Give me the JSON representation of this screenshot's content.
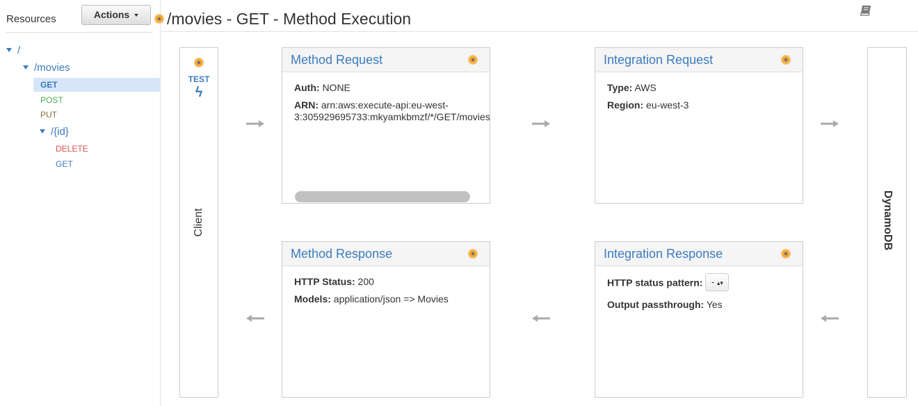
{
  "sidebar": {
    "title": "Resources",
    "actions_label": "Actions",
    "tree": {
      "root": "/",
      "movies": "/movies",
      "movies_methods": {
        "get": "GET",
        "post": "POST",
        "put": "PUT"
      },
      "id": "/{id}",
      "id_methods": {
        "delete": "DELETE",
        "get": "GET"
      }
    }
  },
  "header": {
    "title": "/movies - GET - Method Execution"
  },
  "client": {
    "test_label": "TEST",
    "bolt": "ϟ",
    "label": "Client"
  },
  "backend": {
    "label": "DynamoDB"
  },
  "method_request": {
    "title": "Method Request",
    "auth_label": "Auth:",
    "auth_value": "NONE",
    "arn_label": "ARN:",
    "arn_value": "arn:aws:execute-api:eu-west-3:305929695733:mkyamkbmzf/*/GET/movies"
  },
  "integration_request": {
    "title": "Integration Request",
    "type_label": "Type:",
    "type_value": "AWS",
    "region_label": "Region:",
    "region_value": "eu-west-3"
  },
  "method_response": {
    "title": "Method Response",
    "status_label": "HTTP Status:",
    "status_value": "200",
    "models_label": "Models:",
    "models_value": "application/json => Movies"
  },
  "integration_response": {
    "title": "Integration Response",
    "pattern_label": "HTTP status pattern:",
    "pattern_value": "-",
    "passthrough_label": "Output passthrough:",
    "passthrough_value": "Yes"
  },
  "colors": {
    "link": "#3b7bbf",
    "post": "#4cae4c",
    "put": "#8a6d3b",
    "delete": "#d9534f",
    "accent": "#f5a623",
    "selected_bg": "#d6e6f8"
  },
  "icons": [
    "orange-resource-icon",
    "book-icon",
    "lightning-icon",
    "caret-down-icon",
    "arrow-right-icon",
    "arrow-left-icon",
    "stepper-icon"
  ]
}
